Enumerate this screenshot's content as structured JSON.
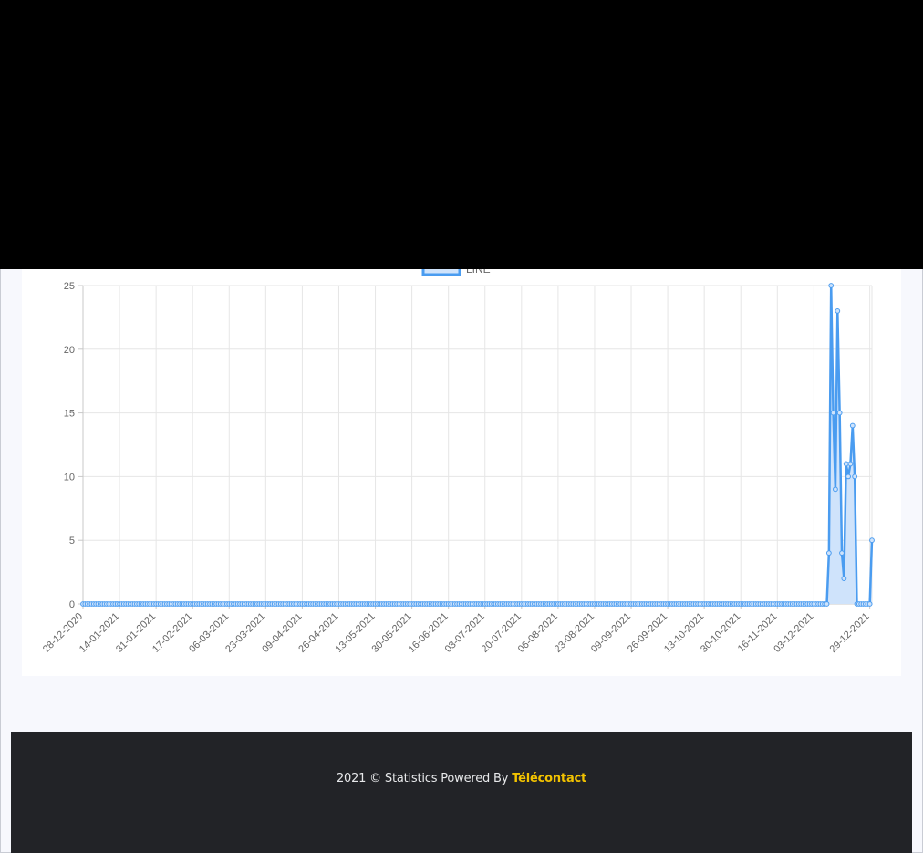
{
  "chart_data": {
    "type": "line",
    "legend": {
      "label": "LINE",
      "position": "top"
    },
    "ylim": [
      0,
      25
    ],
    "yticks": [
      0,
      5,
      10,
      15,
      20,
      25
    ],
    "x_start": "28-12-2020",
    "x_end": "30-12-2021",
    "xtick_labels": [
      "28-12-2020",
      "14-01-2021",
      "31-01-2021",
      "17-02-2021",
      "06-03-2021",
      "23-03-2021",
      "09-04-2021",
      "26-04-2021",
      "13-05-2021",
      "30-05-2021",
      "16-06-2021",
      "03-07-2021",
      "20-07-2021",
      "06-08-2021",
      "23-08-2021",
      "09-09-2021",
      "26-09-2021",
      "13-10-2021",
      "30-10-2021",
      "16-11-2021",
      "03-12-2021",
      "29-12-2021"
    ],
    "grid": true,
    "series": [
      {
        "name": "LINE",
        "color": "#4a9cf0",
        "fill": "#cfe3fb",
        "nonzero_points": [
          {
            "x": "10-12-2021",
            "y": 4
          },
          {
            "x": "11-12-2021",
            "y": 25
          },
          {
            "x": "12-12-2021",
            "y": 15
          },
          {
            "x": "13-12-2021",
            "y": 9
          },
          {
            "x": "14-12-2021",
            "y": 23
          },
          {
            "x": "15-12-2021",
            "y": 15
          },
          {
            "x": "16-12-2021",
            "y": 4
          },
          {
            "x": "17-12-2021",
            "y": 2
          },
          {
            "x": "18-12-2021",
            "y": 11
          },
          {
            "x": "19-12-2021",
            "y": 10
          },
          {
            "x": "20-12-2021",
            "y": 11
          },
          {
            "x": "21-12-2021",
            "y": 14
          },
          {
            "x": "22-12-2021",
            "y": 10
          },
          {
            "x": "30-12-2021",
            "y": 5
          }
        ],
        "default_value": 0
      }
    ]
  },
  "footer": {
    "text": "2021 © Statistics Powered By ",
    "brand": "Télécontact"
  }
}
